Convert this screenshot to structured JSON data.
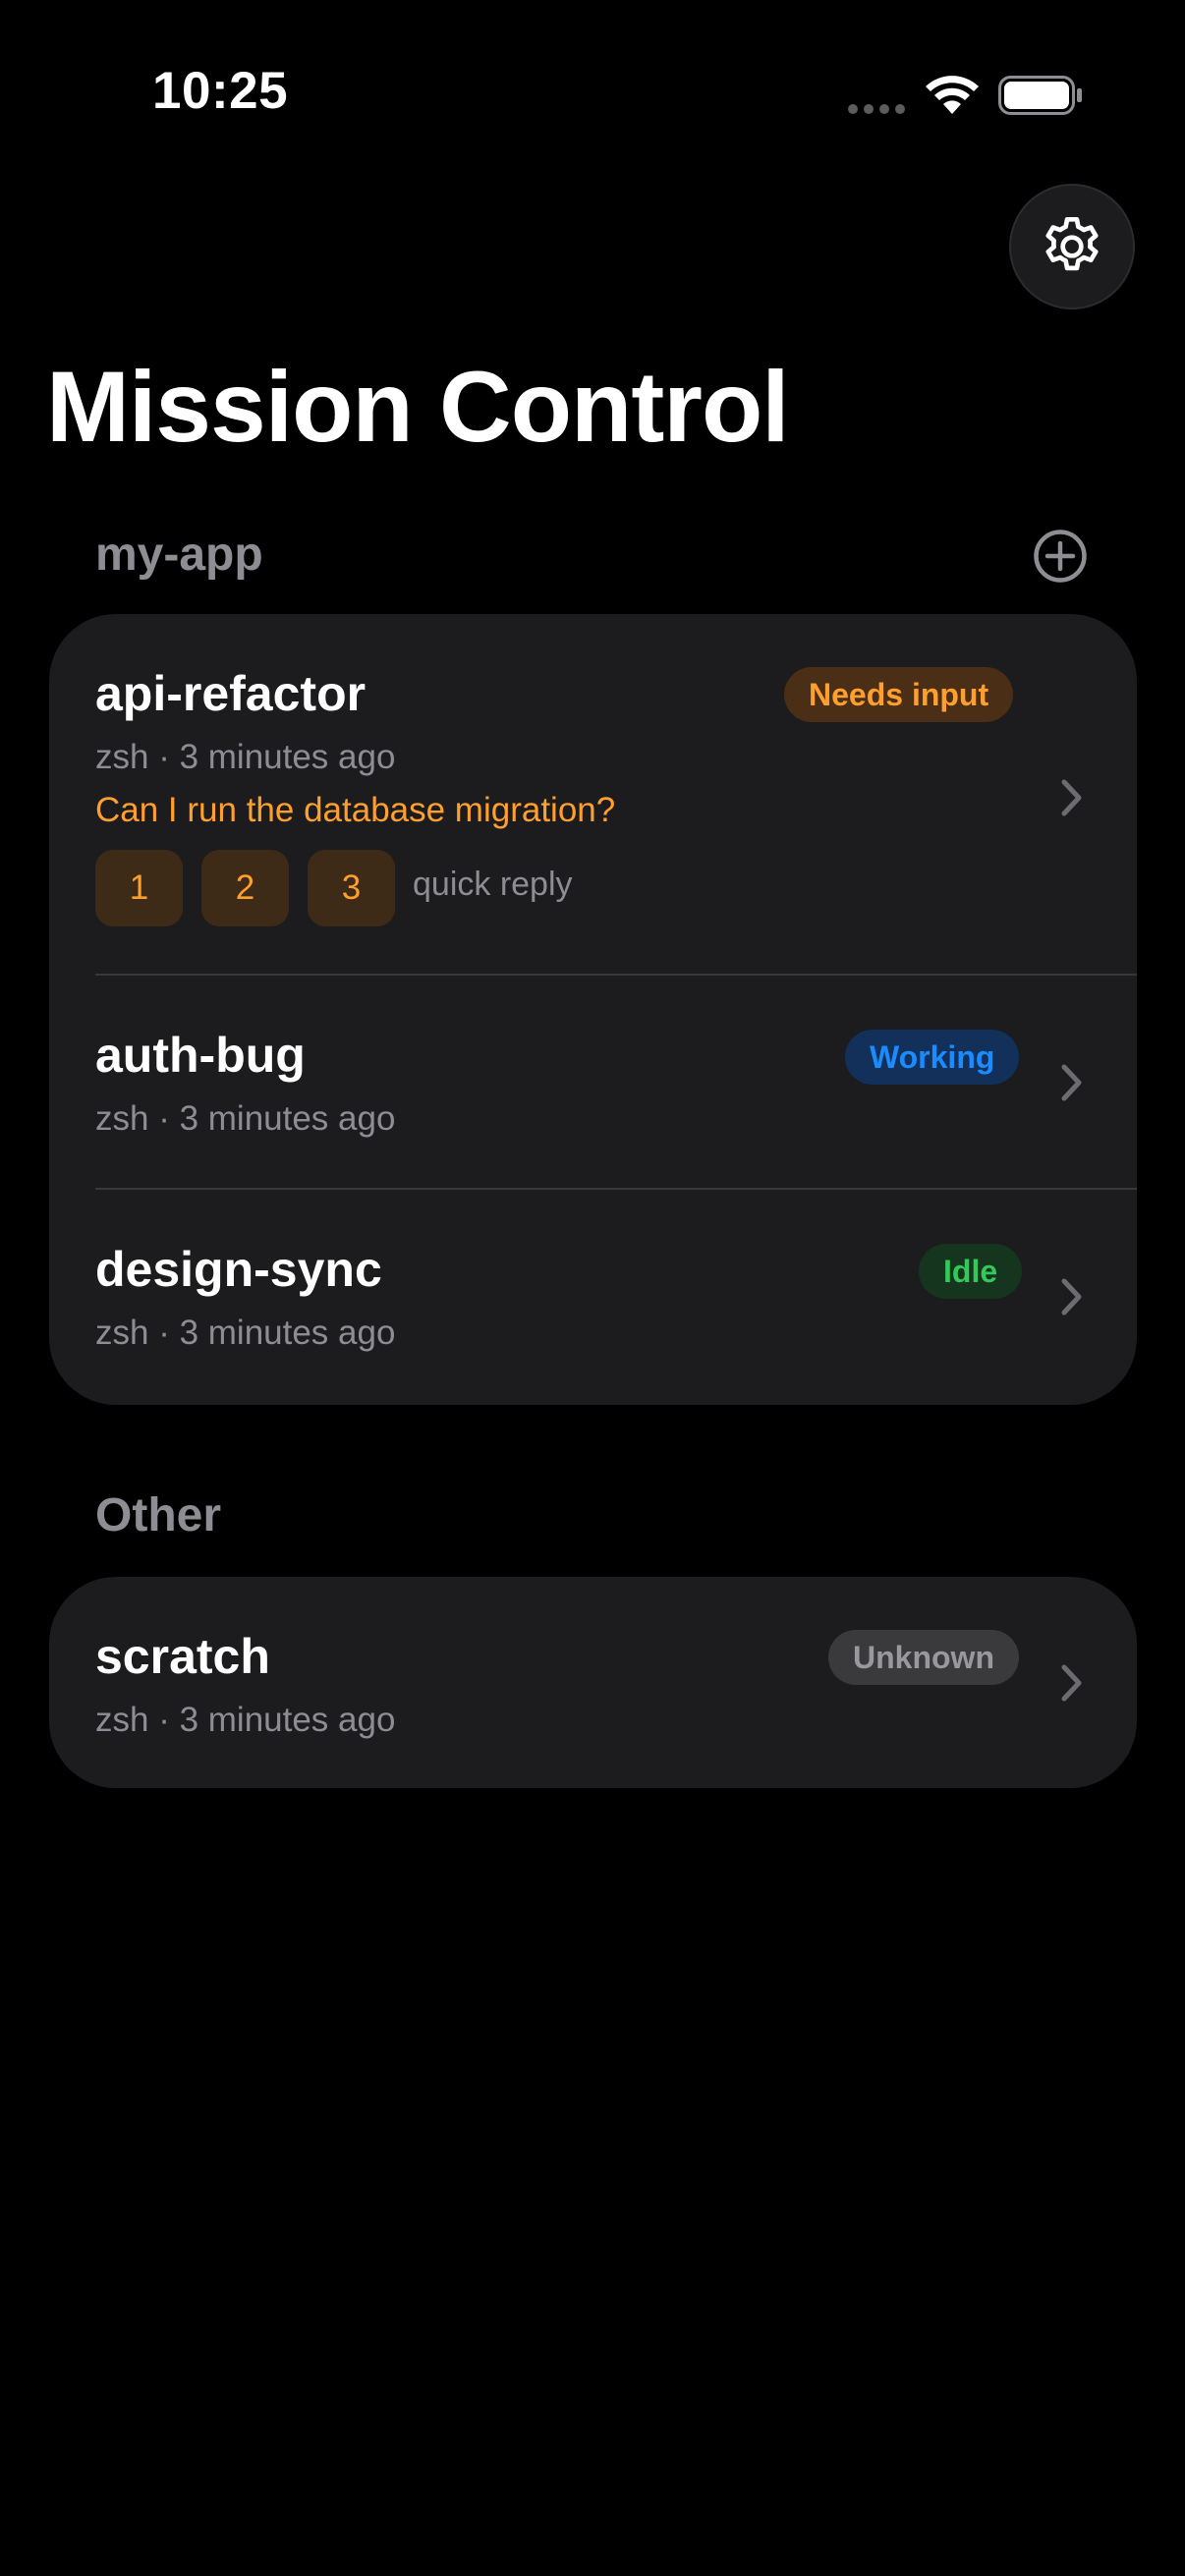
{
  "status_bar": {
    "time": "10:25"
  },
  "header": {
    "title": "Mission Control",
    "settings_icon": "gear-icon"
  },
  "sections": [
    {
      "name": "my-app",
      "add_icon": "plus-circle-icon",
      "sessions": [
        {
          "name": "api-refactor",
          "subtitle": "zsh · 3 minutes ago",
          "status": "Needs input",
          "question": "Can I run the database migration?",
          "quick_replies": [
            "1",
            "2",
            "3"
          ],
          "quick_reply_label": "quick reply"
        },
        {
          "name": "auth-bug",
          "subtitle": "zsh · 3 minutes ago",
          "status": "Working"
        },
        {
          "name": "design-sync",
          "subtitle": "zsh · 3 minutes ago",
          "status": "Idle"
        }
      ]
    },
    {
      "name": "Other",
      "sessions": [
        {
          "name": "scratch",
          "subtitle": "zsh · 3 minutes ago",
          "status": "Unknown"
        }
      ]
    }
  ],
  "colors": {
    "background": "#000000",
    "card": "#1c1c1e",
    "needs_input": "#ff9f2e",
    "working": "#1a8cff",
    "idle": "#34c759",
    "unknown": "#98989d",
    "secondary_text": "#8d8d93"
  }
}
